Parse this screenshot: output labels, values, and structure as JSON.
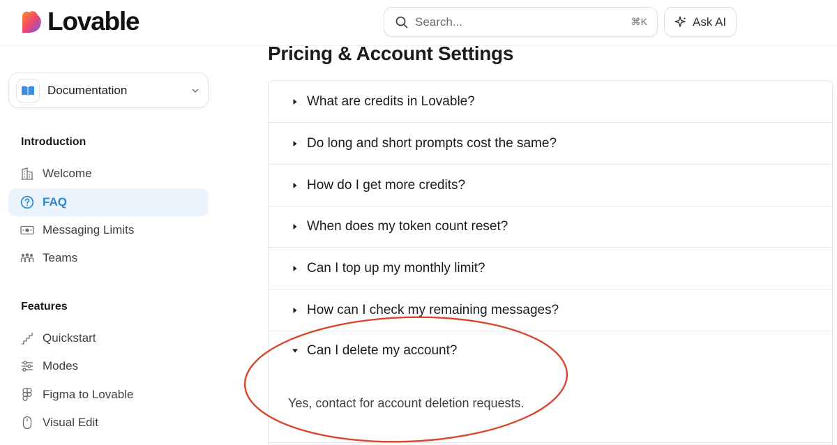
{
  "header": {
    "brand": "Lovable",
    "search_placeholder": "Search...",
    "search_shortcut": "⌘K",
    "ask_ai_label": "Ask AI"
  },
  "sidebar": {
    "doc_selector": {
      "label": "Documentation",
      "icon": "book-icon"
    },
    "sections": [
      {
        "title": "Introduction",
        "items": [
          {
            "label": "Welcome",
            "icon": "building-icon",
            "active": false
          },
          {
            "label": "FAQ",
            "icon": "help-circle-icon",
            "active": true
          },
          {
            "label": "Messaging Limits",
            "icon": "banknote-icon",
            "active": false
          },
          {
            "label": "Teams",
            "icon": "users-icon",
            "active": false
          }
        ]
      },
      {
        "title": "Features",
        "items": [
          {
            "label": "Quickstart",
            "icon": "stairs-icon",
            "active": false
          },
          {
            "label": "Modes",
            "icon": "sliders-icon",
            "active": false
          },
          {
            "label": "Figma to Lovable",
            "icon": "figma-icon",
            "active": false
          },
          {
            "label": "Visual Edit",
            "icon": "mouse-icon",
            "active": false
          }
        ]
      }
    ]
  },
  "main": {
    "title": "Pricing & Account Settings",
    "faq": [
      {
        "question": "What are credits in Lovable?",
        "expanded": false
      },
      {
        "question": "Do long and short prompts cost the same?",
        "expanded": false
      },
      {
        "question": "How do I get more credits?",
        "expanded": false
      },
      {
        "question": "When does my token count reset?",
        "expanded": false
      },
      {
        "question": "Can I top up my monthly limit?",
        "expanded": false
      },
      {
        "question": "How can I check my remaining messages?",
        "expanded": false
      },
      {
        "question": "Can I delete my account?",
        "expanded": true,
        "answer": "Yes, contact for account deletion requests."
      }
    ]
  },
  "colors": {
    "accent": "#2b87d1",
    "active_bg": "#ebf4fd",
    "annotation": "#d9472b"
  }
}
